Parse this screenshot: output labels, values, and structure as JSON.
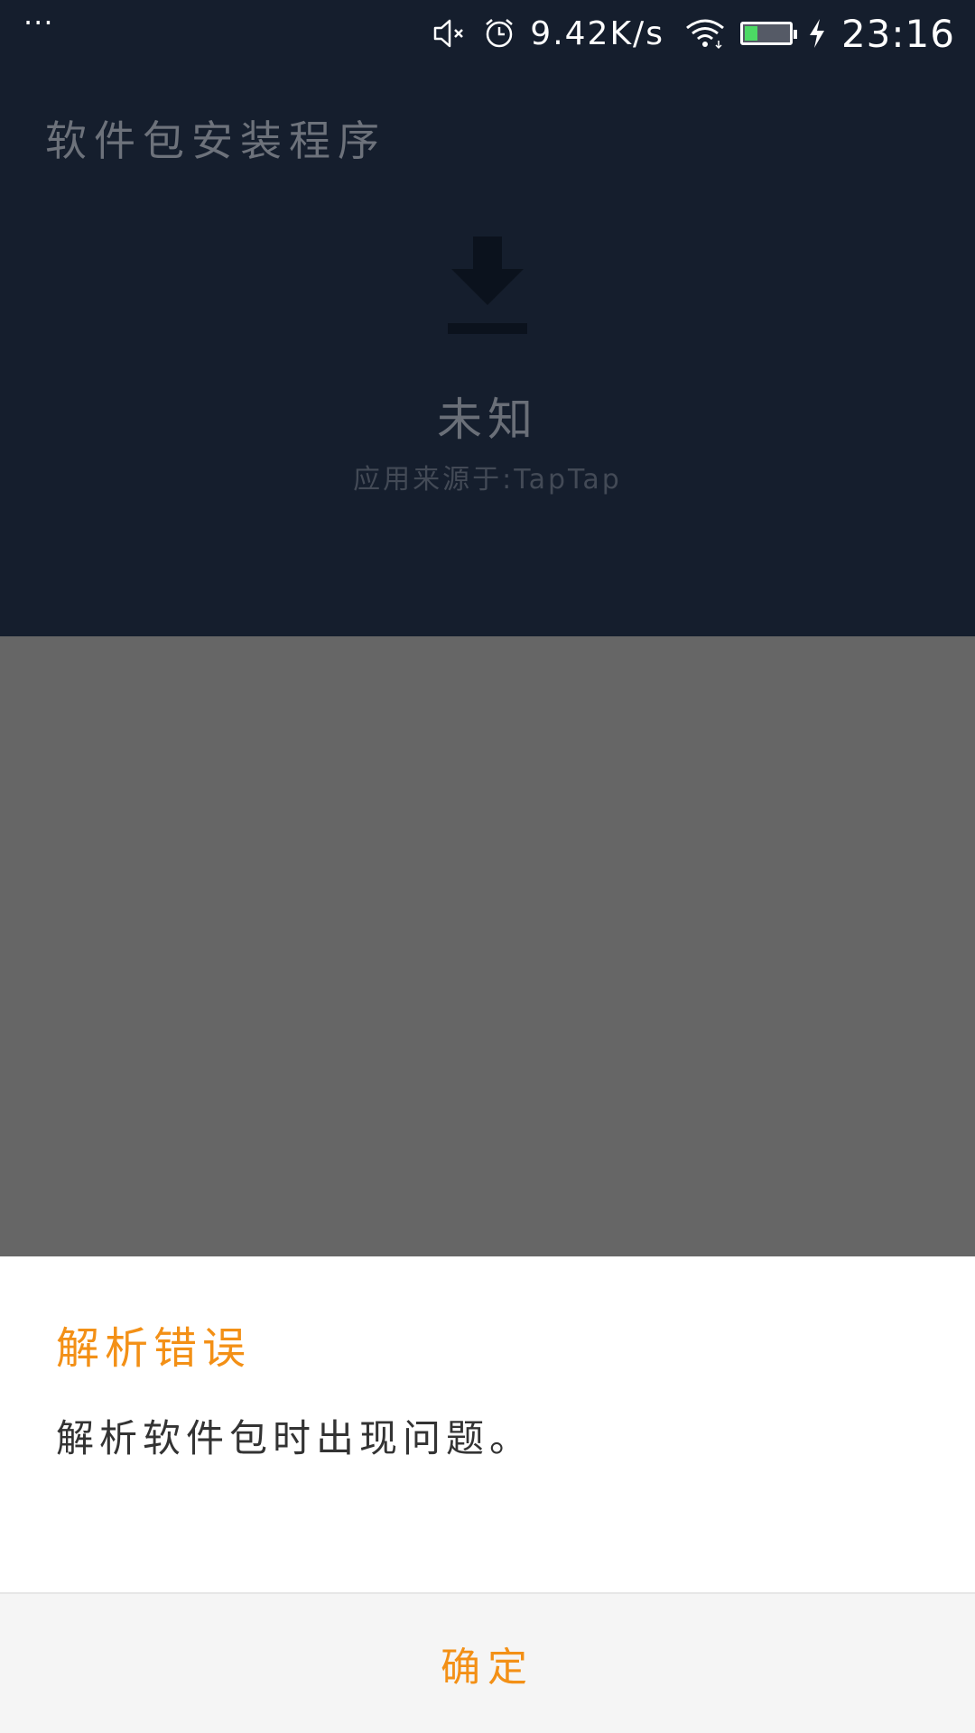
{
  "status_bar": {
    "menu_dots": "···",
    "net_speed": "9.42K/s",
    "time": "23:16",
    "battery_level": 0.3,
    "icons": [
      "mute-icon",
      "alarm-icon",
      "wifi-icon",
      "battery-icon",
      "charging-icon"
    ]
  },
  "installer": {
    "title": "软件包安装程序",
    "app_name": "未知",
    "app_source": "应用来源于:TapTap",
    "icon": "download-icon"
  },
  "dialog": {
    "title": "解析错误",
    "message": "解析软件包时出现问题。",
    "confirm_label": "确定"
  },
  "colors": {
    "accent": "#f39016",
    "panel": "#151e2d",
    "scrim": "#666666"
  }
}
